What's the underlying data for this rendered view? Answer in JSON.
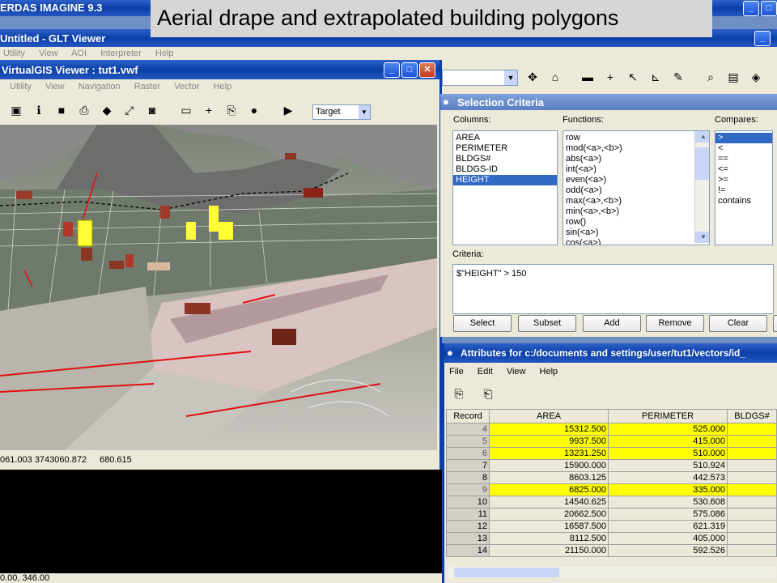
{
  "main_window": {
    "title": "ERDAS IMAGINE 9.3"
  },
  "slide_title": "Aerial drape and extrapolated building polygons",
  "glt_viewer": {
    "title": "Untitled - GLT Viewer",
    "menu": [
      "Utility",
      "View",
      "AOI",
      "Interpreter",
      "Help"
    ]
  },
  "vgis": {
    "title": "VirtualGIS Viewer : tut1.vwf",
    "menu": [
      "Utility",
      "View",
      "Navigation",
      "Raster",
      "Vector",
      "Help"
    ],
    "target_select": "Target",
    "status": {
      "coords": "061.003  3743060.872",
      "value": "680.615"
    }
  },
  "bottom_status": "0.00, 346.00",
  "selection_criteria": {
    "title": "Selection Criteria",
    "columns_label": "Columns:",
    "functions_label": "Functions:",
    "compares_label": "Compares:",
    "columns": [
      "AREA",
      "PERIMETER",
      "BLDGS#",
      "BLDGS-ID",
      "HEIGHT"
    ],
    "selected_column": "HEIGHT",
    "functions": [
      "row",
      "mod(<a>,<b>)",
      "abs(<a>)",
      "int(<a>)",
      "even(<a>)",
      "odd(<a>)",
      "max(<a>,<b>)",
      "min(<a>,<b>)",
      "row()",
      "sin(<a>)",
      "cos(<a>)"
    ],
    "compares": [
      ">",
      "<",
      "==",
      "<=",
      ">=",
      "!=",
      "contains"
    ],
    "selected_compare": ">",
    "criteria_label": "Criteria:",
    "criteria_value": "$\"HEIGHT\" > 150",
    "buttons": {
      "select": "Select",
      "subset": "Subset",
      "add": "Add",
      "remove": "Remove",
      "clear": "Clear"
    }
  },
  "attributes": {
    "title": "Attributes for c:/documents and settings/user/tut1/vectors/id_",
    "menu": [
      "File",
      "Edit",
      "View",
      "Help"
    ],
    "columns": [
      "Record",
      "AREA",
      "PERIMETER",
      "BLDGS#"
    ],
    "rows": [
      {
        "record": "4",
        "area": "15312.500",
        "perimeter": "525.000",
        "highlighted": true
      },
      {
        "record": "5",
        "area": "9937.500",
        "perimeter": "415.000",
        "highlighted": true
      },
      {
        "record": "6",
        "area": "13231.250",
        "perimeter": "510.000",
        "highlighted": true
      },
      {
        "record": "7",
        "area": "15900.000",
        "perimeter": "510.924",
        "highlighted": false
      },
      {
        "record": "8",
        "area": "8603.125",
        "perimeter": "442.573",
        "highlighted": false
      },
      {
        "record": "9",
        "area": "6825.000",
        "perimeter": "335.000",
        "highlighted": true
      },
      {
        "record": "10",
        "area": "14540.625",
        "perimeter": "530.608",
        "highlighted": false
      },
      {
        "record": "11",
        "area": "20662.500",
        "perimeter": "575.086",
        "highlighted": false
      },
      {
        "record": "12",
        "area": "16587.500",
        "perimeter": "621.319",
        "highlighted": false
      },
      {
        "record": "13",
        "area": "8112.500",
        "perimeter": "405.000",
        "highlighted": false
      },
      {
        "record": "14",
        "area": "21150.000",
        "perimeter": "592.526",
        "highlighted": false
      }
    ]
  },
  "colors": {
    "highlight": "#ffff00",
    "selection": "#316ac5",
    "titlebar": "#0b3fa8"
  }
}
